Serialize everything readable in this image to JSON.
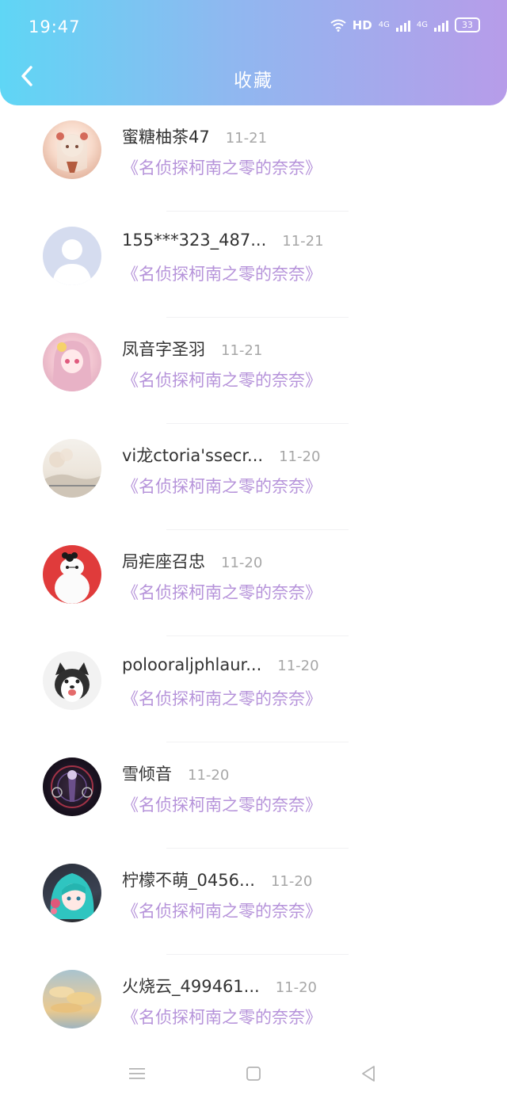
{
  "status_bar": {
    "time": "19:47",
    "network_label": "HD",
    "signal_1": "4G",
    "signal_2": "4G",
    "battery": "33"
  },
  "header": {
    "title": "收藏"
  },
  "favorites": [
    {
      "name": "蜜糖柚茶47",
      "date": "11-21",
      "work": "《名侦探柯南之零的奈奈》"
    },
    {
      "name": "155***323_487...",
      "date": "11-21",
      "work": "《名侦探柯南之零的奈奈》"
    },
    {
      "name": "凤音字圣羽",
      "date": "11-21",
      "work": "《名侦探柯南之零的奈奈》"
    },
    {
      "name": "vi龙ctoria'ssecr...",
      "date": "11-20",
      "work": "《名侦探柯南之零的奈奈》"
    },
    {
      "name": "局疟座召忠",
      "date": "11-20",
      "work": "《名侦探柯南之零的奈奈》"
    },
    {
      "name": "polooraljphlaur...",
      "date": "11-20",
      "work": "《名侦探柯南之零的奈奈》"
    },
    {
      "name": "雪倾音",
      "date": "11-20",
      "work": "《名侦探柯南之零的奈奈》"
    },
    {
      "name": "柠檬不萌_0456...",
      "date": "11-20",
      "work": "《名侦探柯南之零的奈奈》"
    },
    {
      "name": "火烧云_499461...",
      "date": "11-20",
      "work": "《名侦探柯南之零的奈奈》"
    }
  ],
  "icons": {
    "back": "chevron-left-icon",
    "menu": "menu-icon",
    "home": "home-square-icon",
    "back_nav": "back-triangle-icon"
  }
}
